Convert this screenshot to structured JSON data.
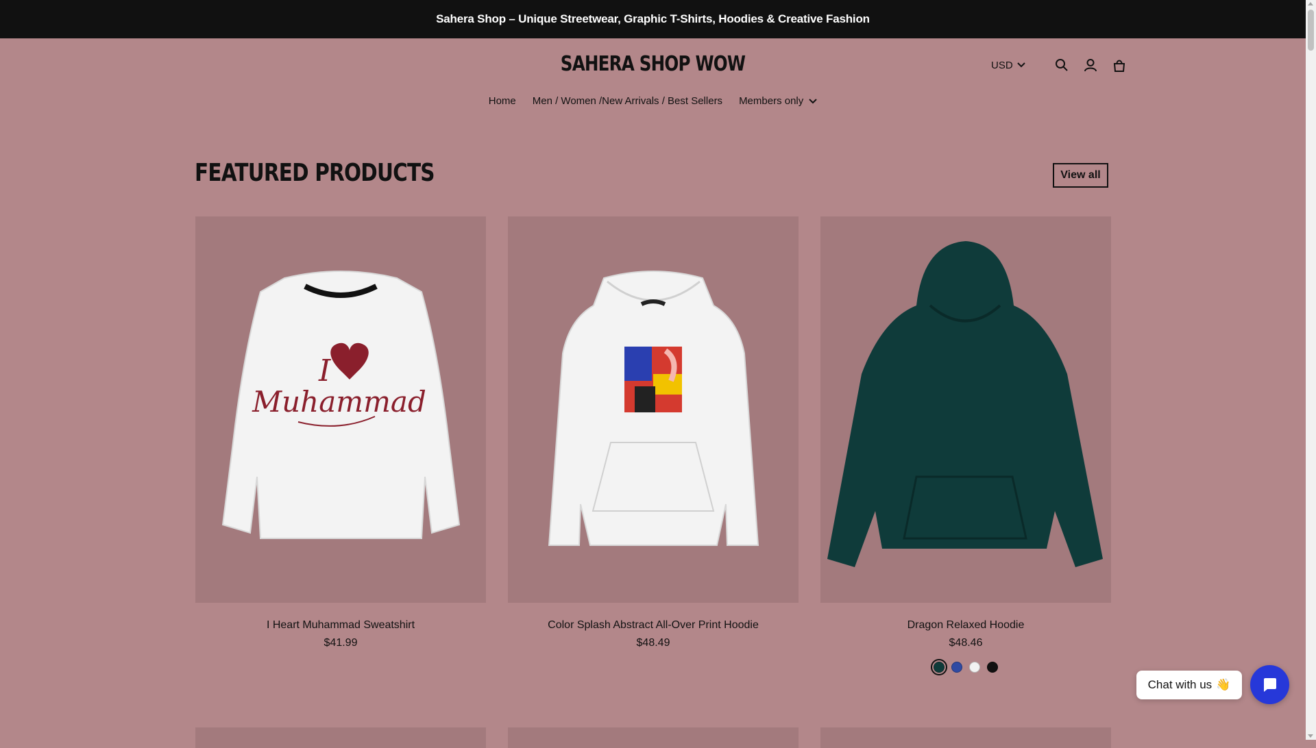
{
  "announcement": {
    "text": "Sahera Shop – Unique Streetwear, Graphic T-Shirts, Hoodies & Creative Fashion"
  },
  "header": {
    "logo": "SAHERA SHOP WOW",
    "currency": "USD",
    "icons": [
      "search-icon",
      "account-icon",
      "bag-icon"
    ]
  },
  "nav": {
    "items": [
      {
        "label": "Home"
      },
      {
        "label": "Men / Women /New Arrivals / Best Sellers"
      },
      {
        "label": "Members only"
      }
    ]
  },
  "section": {
    "title": "FEATURED PRODUCTS",
    "view_all": "View all"
  },
  "products": [
    {
      "title": "I Heart Muhammad Sweatshirt",
      "price": "$41.99",
      "print_line1": "I",
      "print_line2": "Muhammad"
    },
    {
      "title": "Color Splash Abstract All-Over Print Hoodie",
      "price": "$48.49"
    },
    {
      "title": "Dragon Relaxed Hoodie",
      "price": "$48.46",
      "swatches": [
        "#0f3b3a",
        "#2f4aa3",
        "#f2f2f2",
        "#111111"
      ]
    }
  ],
  "chat": {
    "label": "Chat with us",
    "emoji": "👋"
  },
  "colors": {
    "page_background": "#b3878a",
    "card_background": "#a37a7d",
    "announcement_background": "#111111",
    "chat_button": "#2638d9"
  }
}
